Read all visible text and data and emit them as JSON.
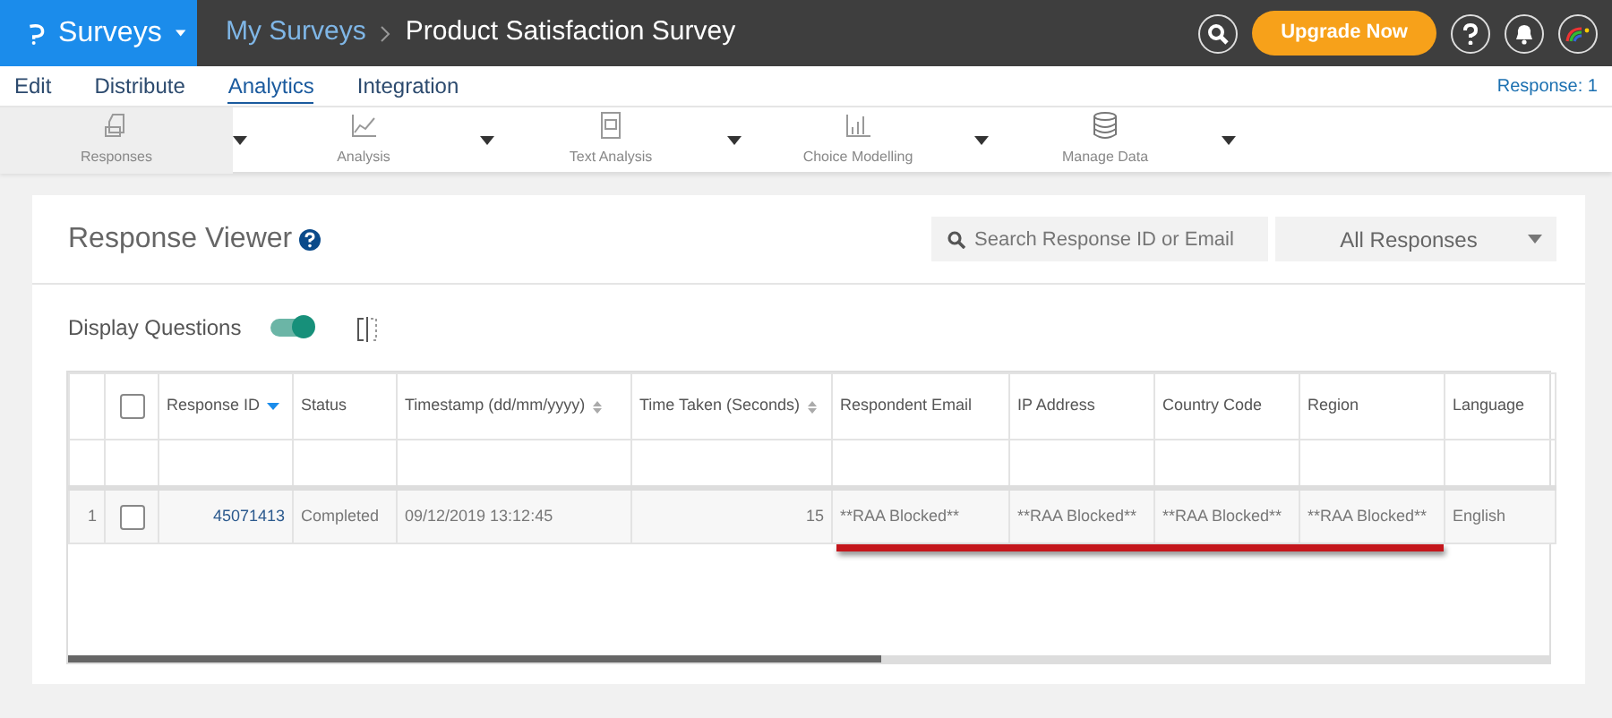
{
  "topbar": {
    "app": "Surveys",
    "breadcrumb": "My Surveys",
    "title": "Product Satisfaction Survey",
    "upgrade": "Upgrade Now"
  },
  "menu": [
    {
      "label": "Edit",
      "selected": false
    },
    {
      "label": "Distribute",
      "selected": false
    },
    {
      "label": "Analytics",
      "selected": true
    },
    {
      "label": "Integration",
      "selected": false
    }
  ],
  "response_count": "Response: 1",
  "toolbar": [
    {
      "label": "Responses",
      "kind": "responses",
      "selected": true
    },
    {
      "label": "Analysis",
      "kind": "analysis",
      "selected": false
    },
    {
      "label": "Text Analysis",
      "kind": "text",
      "selected": false
    },
    {
      "label": "Choice Modelling",
      "kind": "choice",
      "selected": false
    },
    {
      "label": "Manage Data",
      "kind": "data",
      "selected": false
    }
  ],
  "viewer": {
    "title": "Response Viewer",
    "search": {
      "placeholder": "Search Response ID or Email"
    },
    "filter": "All Responses",
    "display_questions": {
      "label": "Display Questions",
      "on": true
    }
  },
  "table": {
    "header_checkbox": {
      "checked": false
    },
    "columns": [
      {
        "label": "Response ID",
        "sorted": true,
        "sortable": true
      },
      {
        "label": "Status"
      },
      {
        "label": "Timestamp (dd/mm/yyyy)",
        "sorted": false,
        "sortable": true
      },
      {
        "label": "Time Taken (Seconds)",
        "sorted": false,
        "sortable": true
      },
      {
        "label": "Respondent Email"
      },
      {
        "label": "IP Address"
      },
      {
        "label": "Country Code"
      },
      {
        "label": "Region"
      },
      {
        "label": "Language"
      }
    ],
    "rows": [
      {
        "number": "1",
        "checked": false,
        "cells": [
          "45071413",
          "Completed",
          "09/12/2019 13:12:45",
          "15",
          "**RAA Blocked**",
          "**RAA Blocked**",
          "**RAA Blocked**",
          "**RAA Blocked**",
          "English"
        ]
      }
    ]
  }
}
